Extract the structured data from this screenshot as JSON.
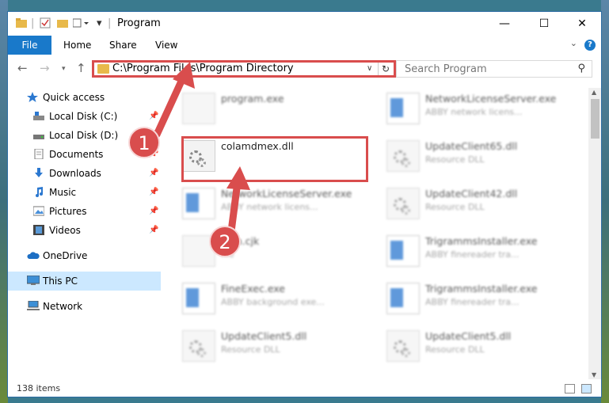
{
  "window": {
    "title": "Program",
    "minimize": "—",
    "maximize": "☐",
    "close": "✕"
  },
  "ribbon": {
    "tabs": [
      "File",
      "Home",
      "Share",
      "View"
    ],
    "help": "?"
  },
  "address": {
    "path": "C:\\Program Files\\Program Directory",
    "search_placeholder": "Search Program"
  },
  "sidebar": {
    "items": [
      {
        "label": "Quick access",
        "icon": "star-icon"
      },
      {
        "label": "Local Disk (C:)",
        "icon": "drive-icon"
      },
      {
        "label": "Local Disk (D:)",
        "icon": "drive-icon"
      },
      {
        "label": "Documents",
        "icon": "documents-icon"
      },
      {
        "label": "Downloads",
        "icon": "download-icon"
      },
      {
        "label": "Music",
        "icon": "music-icon"
      },
      {
        "label": "Pictures",
        "icon": "pictures-icon"
      },
      {
        "label": "Videos",
        "icon": "videos-icon"
      },
      {
        "label": "OneDrive",
        "icon": "cloud-icon"
      },
      {
        "label": "This PC",
        "icon": "computer-icon"
      },
      {
        "label": "Network",
        "icon": "network-icon"
      }
    ]
  },
  "files": [
    {
      "name": "program.exe",
      "desc": ""
    },
    {
      "name": "NetworkLicenseServer.exe",
      "desc": "ABBY network licens..."
    },
    {
      "name": "colamdmex.dll",
      "desc": ""
    },
    {
      "name": "UpdateClient65.dll",
      "desc": "Resource DLL"
    },
    {
      "name": "NetworkLicenseServer.exe",
      "desc": "ABBY network licens..."
    },
    {
      "name": "UpdateClient42.dll",
      "desc": "Resource DLL"
    },
    {
      "name": "com.cjk",
      "desc": "file"
    },
    {
      "name": "TrigrammsInstaller.exe",
      "desc": "ABBY finereader tra..."
    },
    {
      "name": "FineExec.exe",
      "desc": "ABBY background exe..."
    },
    {
      "name": "TrigrammsInstaller.exe",
      "desc": "ABBY finereader tra..."
    },
    {
      "name": "UpdateClient5.dll",
      "desc": "Resource DLL"
    },
    {
      "name": "UpdateClient5.dll",
      "desc": "Resource DLL"
    }
  ],
  "status": {
    "count": "138 items"
  },
  "annotations": {
    "step1": "1",
    "step2": "2"
  },
  "colors": {
    "accent": "#1979ca",
    "highlight": "#d94d4d"
  }
}
